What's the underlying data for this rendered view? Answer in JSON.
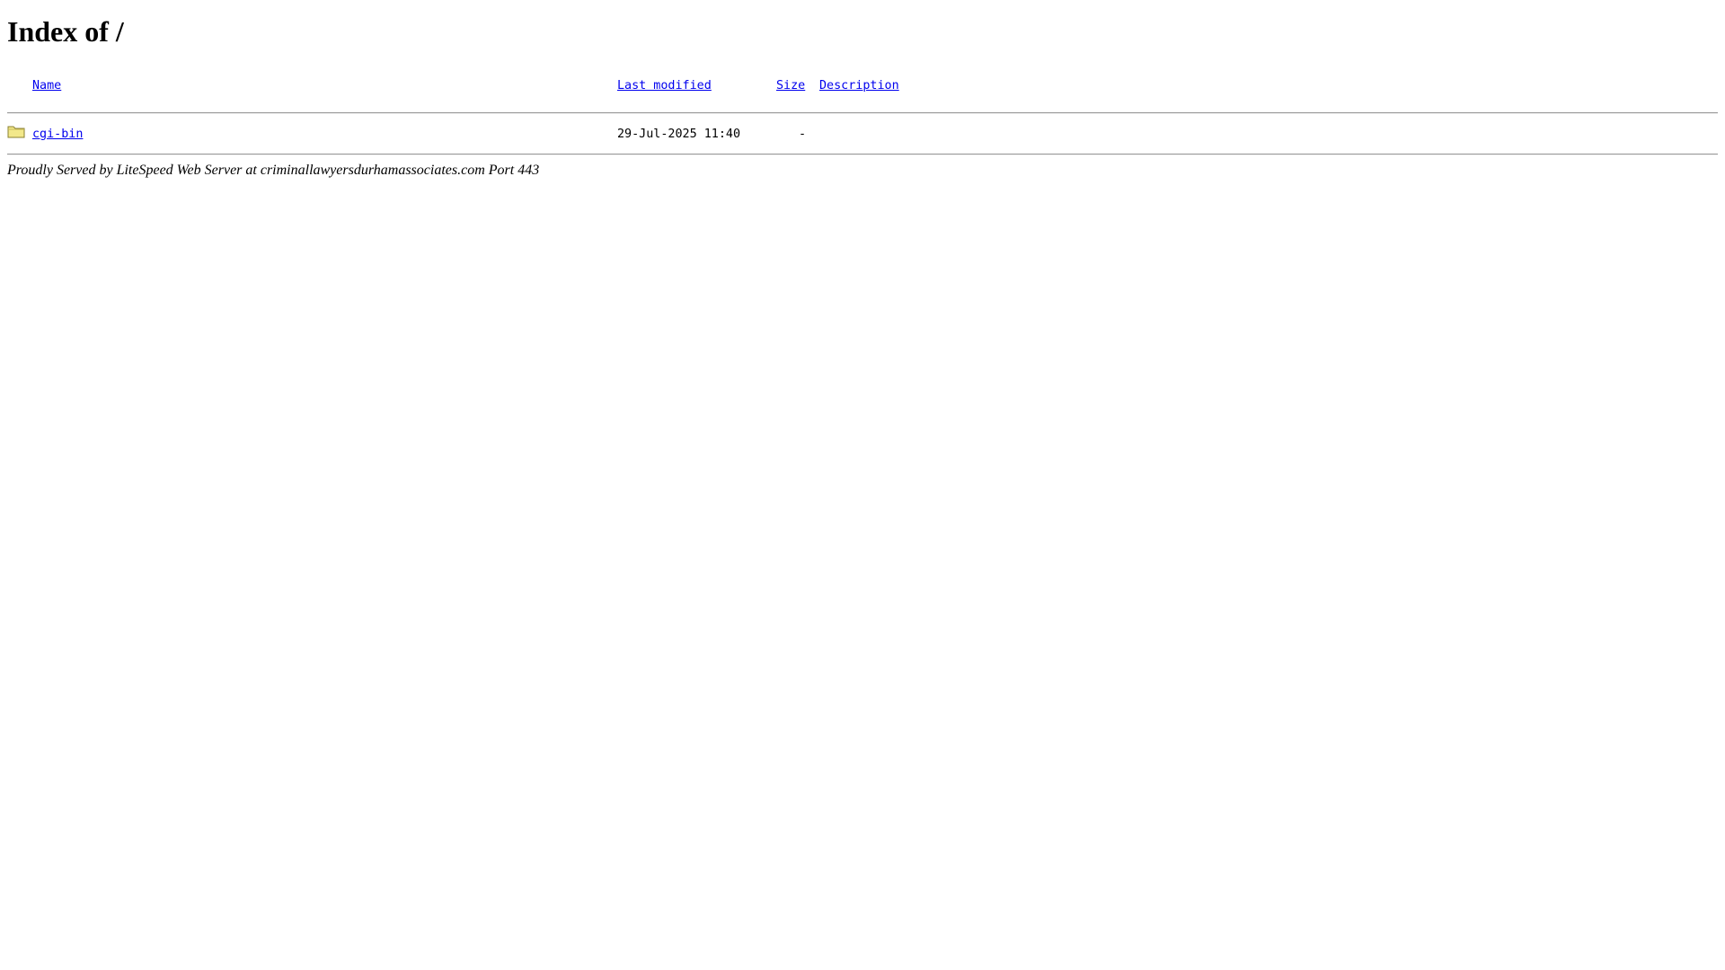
{
  "page": {
    "title": "Index of /"
  },
  "listing": {
    "headers": {
      "name": "Name",
      "last_modified": "Last modified",
      "size": "Size",
      "description": "Description"
    },
    "rows": [
      {
        "icon": "folder-icon",
        "name": "cgi-bin",
        "last_modified": "29-Jul-2025 11:40",
        "size": "-",
        "description": ""
      }
    ]
  },
  "footer": {
    "text": "Proudly Served by LiteSpeed Web Server at criminallawyersdurhamassociates.com Port 443"
  },
  "colors": {
    "link": "#0000ee",
    "folder_fill": "#f2e88a",
    "folder_stroke": "#8a8030"
  }
}
